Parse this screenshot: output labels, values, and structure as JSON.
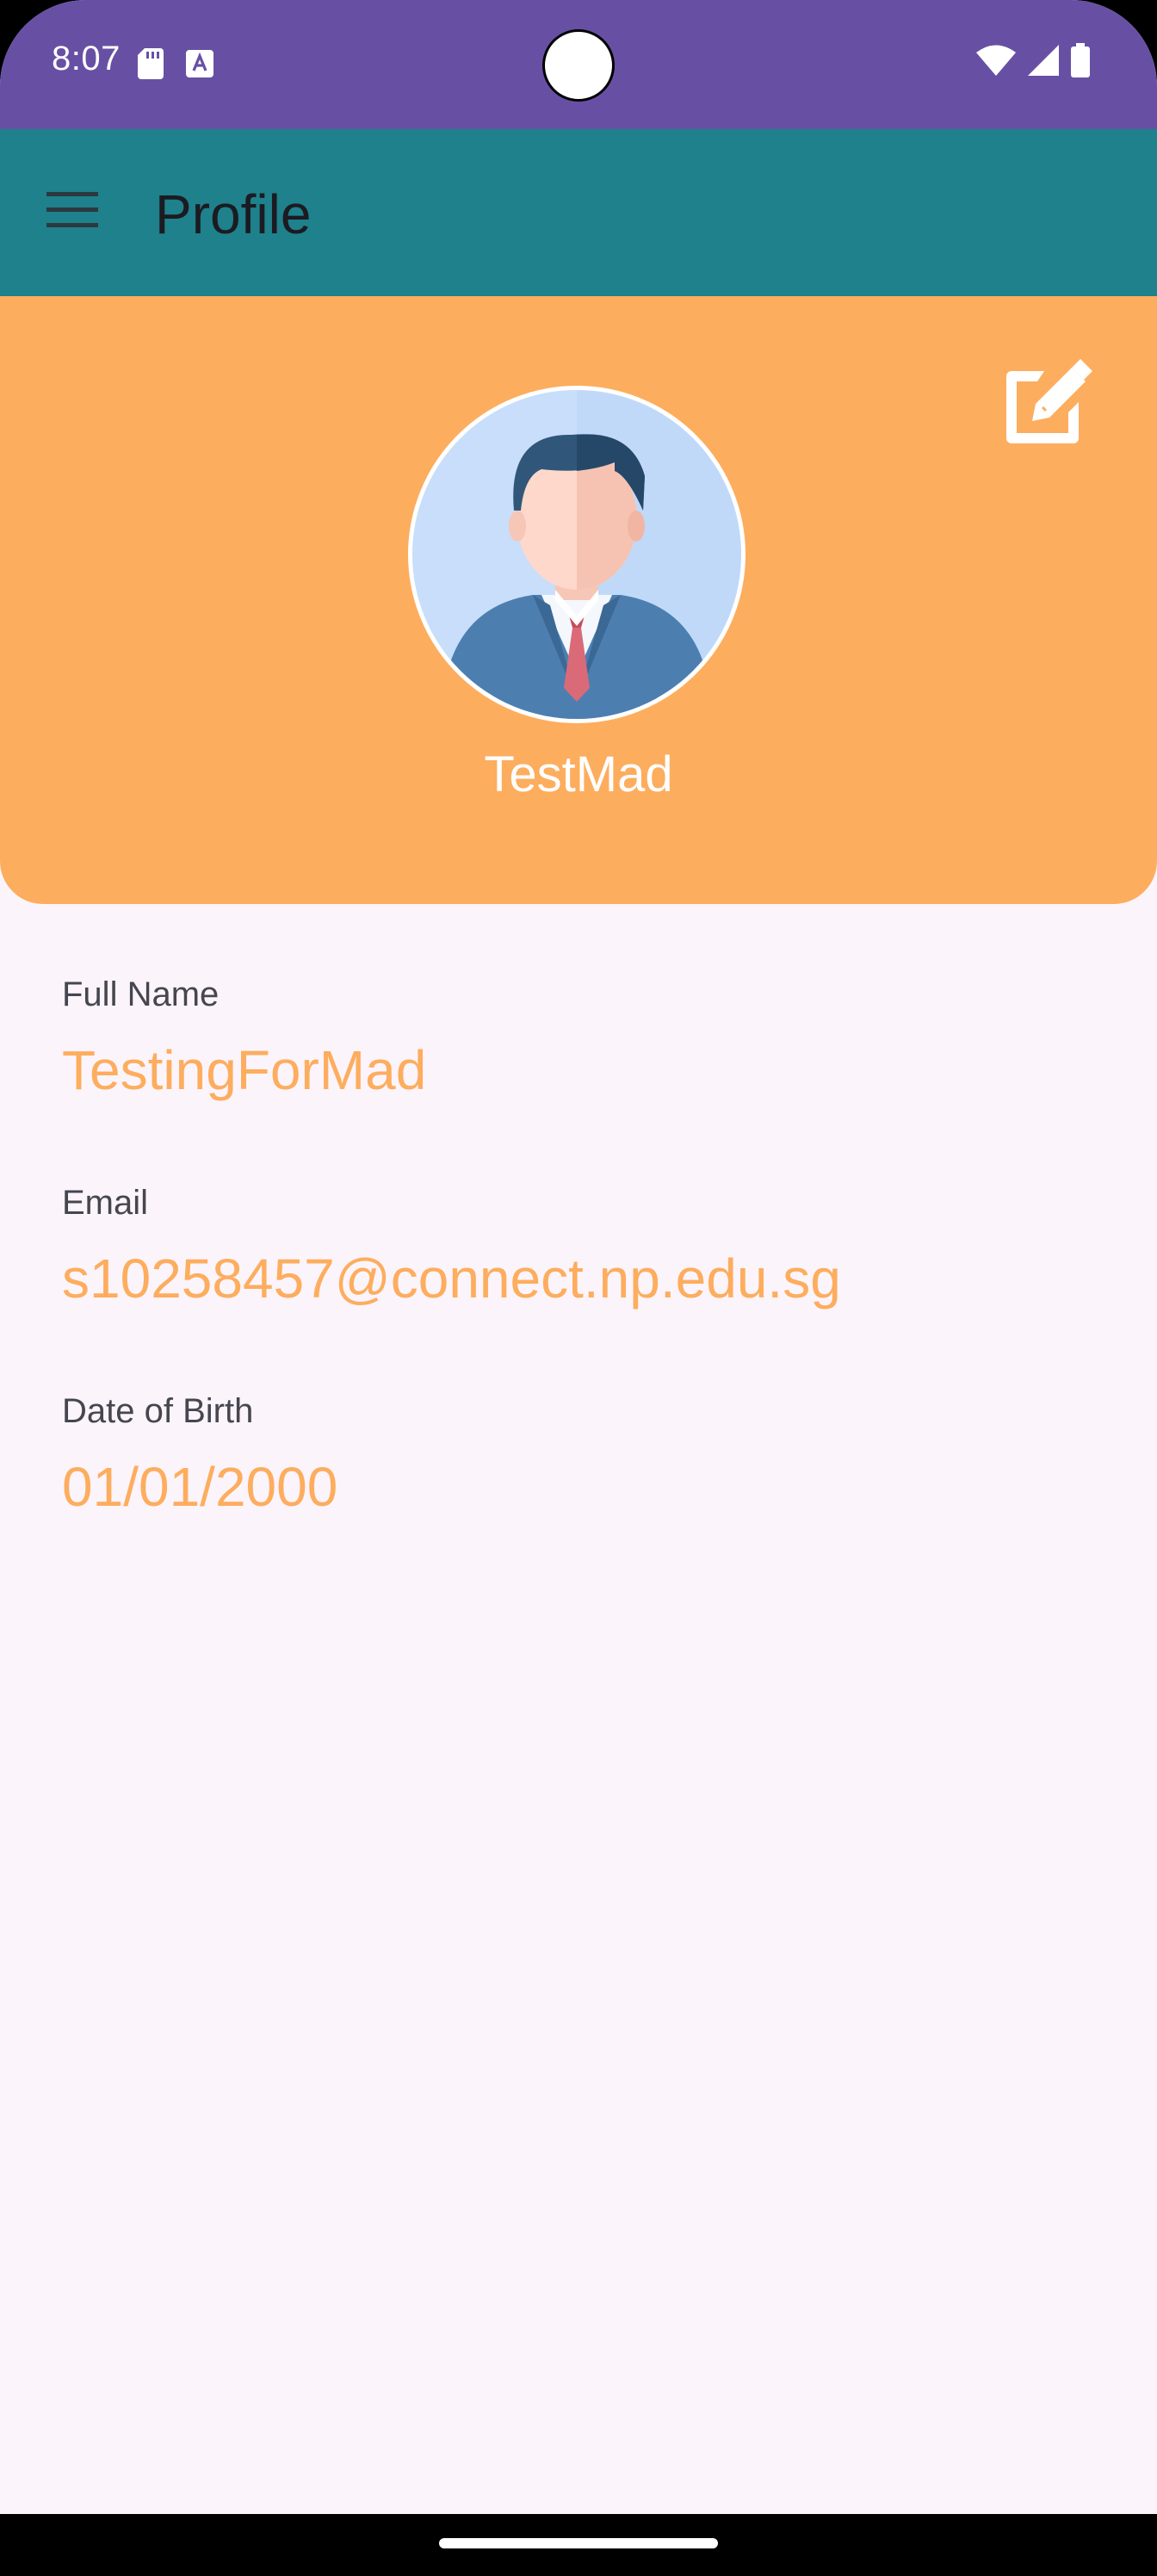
{
  "status_bar": {
    "time": "8:07",
    "icons": [
      "sd-card-icon",
      "keyboard-a-icon",
      "wifi-icon",
      "cellular-signal-icon",
      "battery-icon"
    ],
    "background_color": "#6750A4"
  },
  "app_bar": {
    "title": "Profile",
    "menu_icon": "hamburger-menu-icon",
    "background_color": "#1E818C"
  },
  "header": {
    "background_color": "#FDAD5E",
    "edit_icon": "edit-icon",
    "avatar_icon": "businessman-avatar",
    "username": "TestMad"
  },
  "fields": [
    {
      "label": "Full Name",
      "value": "TestingForMad"
    },
    {
      "label": "Email",
      "value": "s10258457@connect.np.edu.sg"
    },
    {
      "label": "Date of Birth",
      "value": "01/01/2000"
    }
  ],
  "colors": {
    "accent": "#FDAD5E",
    "page_background": "#FCF4FB",
    "label_text": "#45464F"
  }
}
